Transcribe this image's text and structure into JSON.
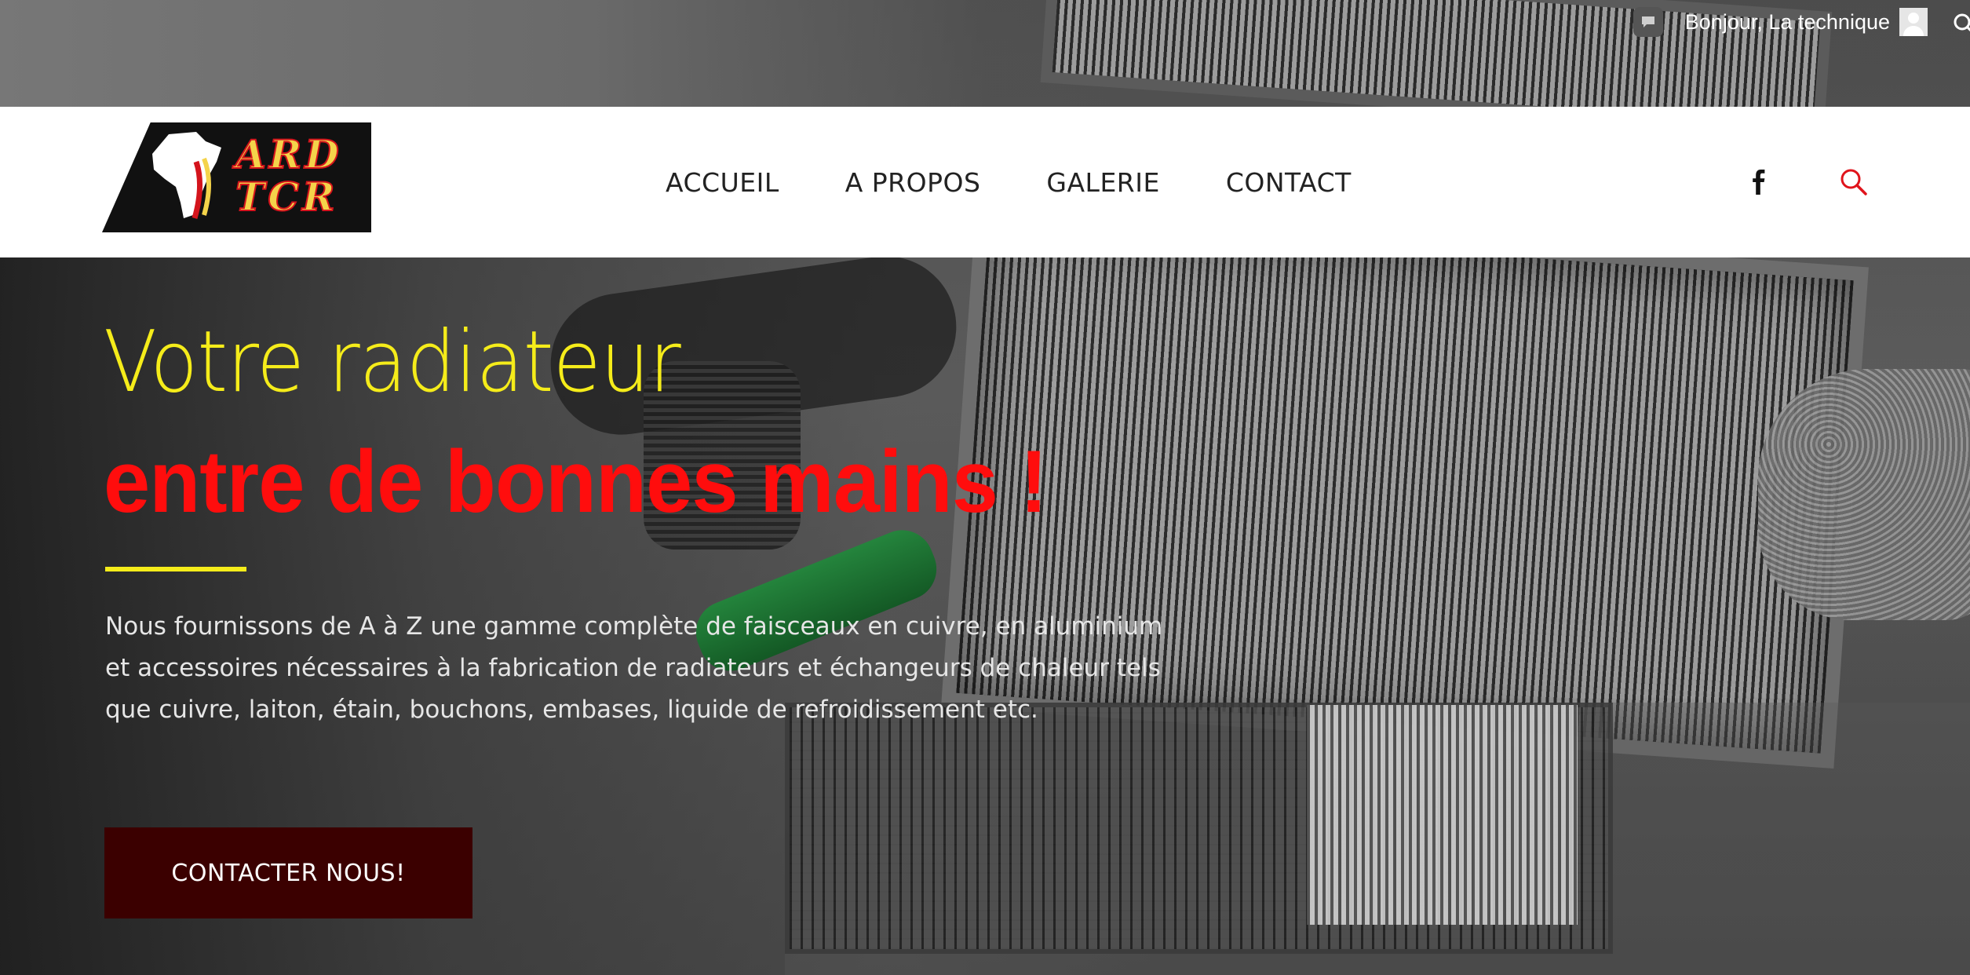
{
  "topbar": {
    "greeting": "Bonjour, La technique",
    "icons": [
      "comment-icon",
      "user-avatar-icon",
      "search-icon"
    ]
  },
  "logo": {
    "line1": "ARD",
    "line2": "TCR"
  },
  "nav": {
    "items": [
      {
        "label": "ACCUEIL"
      },
      {
        "label": "A PROPOS"
      },
      {
        "label": "GALERIE"
      },
      {
        "label": "CONTACT"
      }
    ],
    "social_icon": "facebook-icon",
    "search_icon": "search-icon"
  },
  "hero": {
    "title_line1": "Votre radiateur",
    "title_line2": "entre de bonnes mains !",
    "description": "Nous fournissons de A à Z une gamme complète de faisceaux en cuivre, en aluminium et accessoires nécessaires à la fabrication de radiateurs et échangeurs de chaleur tels que cuivre, laiton, étain, bouchons, embases, liquide de refroidissement etc.",
    "cta_label": "CONTACTER NOUS!"
  },
  "colors": {
    "title_yellow": "#f5ec1a",
    "title_red": "#ff0d0d",
    "cta_bg": "#3b0000",
    "search_red": "#e0141c"
  }
}
